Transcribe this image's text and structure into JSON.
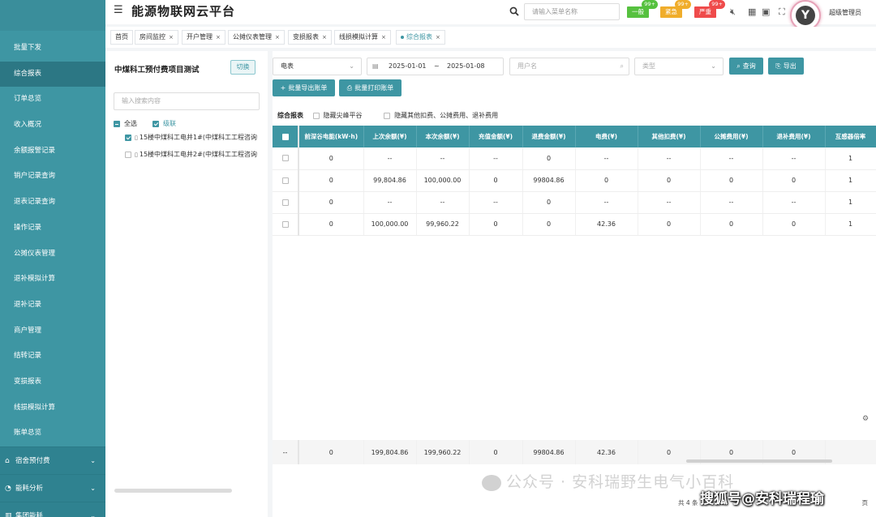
{
  "header": {
    "title": "能源物联网云平台",
    "menu_search_placeholder": "请输入菜单名称",
    "alarms": [
      {
        "label": "一般",
        "count": "99+",
        "color": "#56c13f"
      },
      {
        "label": "紧急",
        "count": "99+",
        "color": "#f0ad2b"
      },
      {
        "label": "严重",
        "count": "99+",
        "color": "#ef4b4b"
      }
    ],
    "avatar_letter": "Y",
    "username": "超级管理员"
  },
  "sidebar": {
    "items": [
      {
        "label": "批量下发"
      },
      {
        "label": "综合报表",
        "active": true
      },
      {
        "label": "订单总览"
      },
      {
        "label": "收入概况"
      },
      {
        "label": "余额报警记录"
      },
      {
        "label": "销户记录查询"
      },
      {
        "label": "退表记录查询"
      },
      {
        "label": "操作记录"
      },
      {
        "label": "公摊仪表管理"
      },
      {
        "label": "退补模拟计算"
      },
      {
        "label": "退补记录"
      },
      {
        "label": "商户管理"
      },
      {
        "label": "结转记录"
      },
      {
        "label": "变损报表"
      },
      {
        "label": "线损模拟计算"
      },
      {
        "label": "账单总览"
      }
    ],
    "groups": [
      {
        "label": "宿舍预付费",
        "icon": "house-icon"
      },
      {
        "label": "能耗分析",
        "icon": "chart-icon"
      },
      {
        "label": "集团能耗",
        "icon": "building-icon"
      }
    ]
  },
  "tabs": [
    {
      "label": "首页",
      "closable": false
    },
    {
      "label": "房间监控",
      "closable": true
    },
    {
      "label": "开户管理",
      "closable": true
    },
    {
      "label": "公摊仪表管理",
      "closable": true
    },
    {
      "label": "变损报表",
      "closable": true
    },
    {
      "label": "线损模拟计算",
      "closable": true
    },
    {
      "label": "综合报表",
      "closable": true,
      "active": true
    }
  ],
  "project": {
    "title": "中煤科工预付费项目测试",
    "switch_label": "切换",
    "search_placeholder": "输入搜索内容",
    "select_all_label": "全选",
    "cascade_label": "级联",
    "nodes": [
      {
        "label": "15楼中煤科工电井1#(中煤科工工程咨询",
        "checked": true
      },
      {
        "label": "15楼中煤科工电井2#(中煤科工工程咨询",
        "checked": false
      }
    ]
  },
  "filters": {
    "meter_type": "电表",
    "date_start": "2025-01-01",
    "date_sep": "~",
    "date_end": "2025-01-08",
    "user_placeholder": "用户名",
    "type_placeholder": "类型",
    "query_label": "查询",
    "export_label": "导出",
    "batch_export_label": "批量导出账单",
    "batch_print_label": "批量打印账单"
  },
  "options": {
    "report_label": "综合报表",
    "hide_peak_label": "隐藏尖峰平谷",
    "hide_other_label": "隐藏其他扣费、公摊费用、退补费用"
  },
  "table": {
    "columns": [
      "前深谷电能(kW·h)",
      "上次余额(¥)",
      "本次余额(¥)",
      "充值金额(¥)",
      "退费金额(¥)",
      "电费(¥)",
      "其他扣费(¥)",
      "公摊费用(¥)",
      "退补费用(¥)",
      "互感器倍率"
    ],
    "rows": [
      [
        "0",
        "--",
        "--",
        "--",
        "0",
        "--",
        "--",
        "--",
        "--",
        "1"
      ],
      [
        "0",
        "99,804.86",
        "100,000.00",
        "0",
        "99804.86",
        "0",
        "0",
        "0",
        "0",
        "1"
      ],
      [
        "0",
        "--",
        "--",
        "--",
        "0",
        "--",
        "--",
        "--",
        "--",
        "1"
      ],
      [
        "0",
        "100,000.00",
        "99,960.22",
        "0",
        "0",
        "42.36",
        "0",
        "0",
        "0",
        "1"
      ]
    ],
    "summary": [
      "--",
      "0",
      "199,804.86",
      "199,960.22",
      "0",
      "99804.86",
      "42.36",
      "0",
      "0",
      "0",
      ""
    ]
  },
  "pager": {
    "total_text": "共 4 条",
    "page_suffix": "页"
  },
  "watermarks": {
    "wechat": "公众号 · 安科瑞野生电气小百科",
    "sohu": "搜狐号@安科瑞程瑜"
  }
}
